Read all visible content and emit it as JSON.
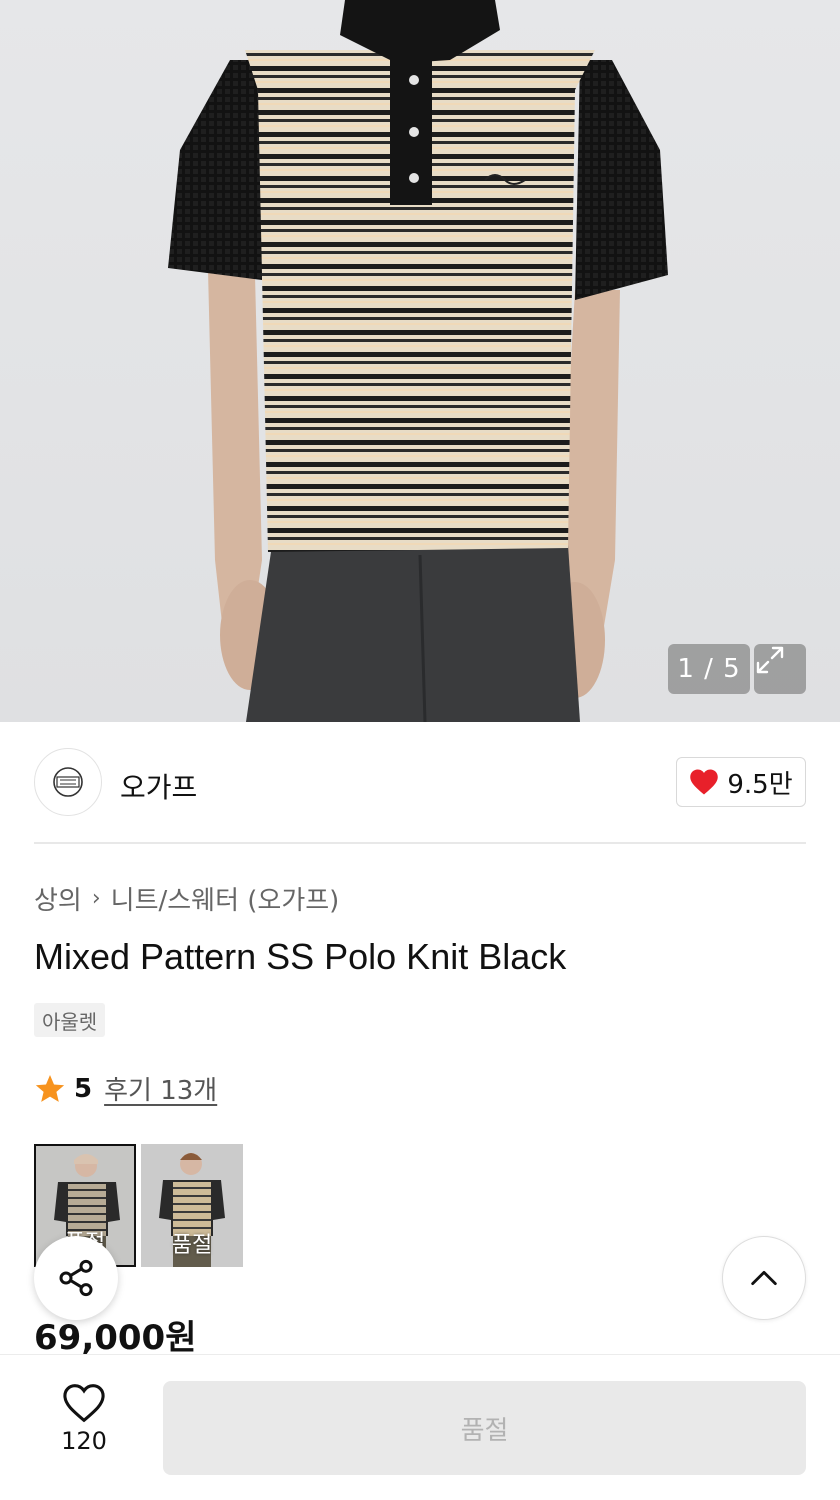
{
  "gallery": {
    "counter": "1 / 5"
  },
  "shop": {
    "name": "오가프",
    "likes": "9.5만"
  },
  "product": {
    "breadcrumb": [
      "상의",
      "니트/스웨터 (오가프)"
    ],
    "title": "Mixed Pattern SS Polo Knit Black",
    "badge": "아울렛",
    "rating": "5",
    "reviews": "후기 13개",
    "price": "69,000원"
  },
  "colors": [
    {
      "label": "품절"
    },
    {
      "label": "품절"
    }
  ],
  "bottom_bar": {
    "wish_count": "120",
    "buy_label": "품절"
  },
  "theme": {
    "heart": "#e8202a",
    "star": "#f7931e"
  }
}
